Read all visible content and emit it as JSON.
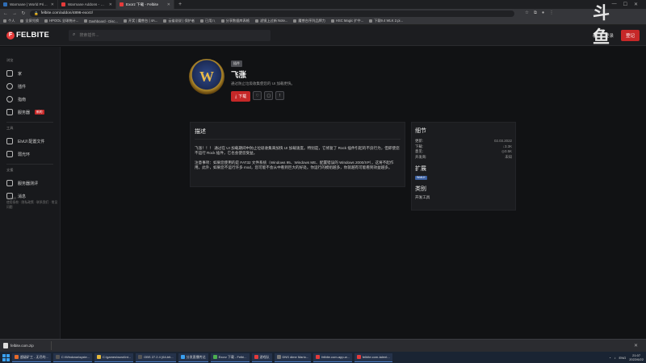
{
  "browser": {
    "tabs": [
      {
        "title": "Warmane | World Private Ser",
        "color": "#2f6db5",
        "active": false
      },
      {
        "title": "Warmane Addons - Felbite",
        "color": "#e53b3b",
        "active": false
      },
      {
        "title": "Exorz 下载 - Felbite",
        "color": "#e53b3b",
        "active": true
      }
    ],
    "new_tab": "+",
    "url": "felbite.com/addon/4896-exorz/",
    "bookmarks": [
      "个人",
      "全屏兑换",
      "HPOOL 全球统计...",
      "Dashboard - Disc...",
      "开奖 | 魔兽台 | 4A...",
      "云雀说说 | 保护者",
      "已用八",
      "分享数据库表格",
      "滤镜上过新 Note...",
      "魔兽台序列品牌力",
      "HSC Magic 扩中...",
      "下载9.4 WLK 2.pi..."
    ]
  },
  "site": {
    "logo_mark": "F",
    "logo_text": "FELBITE",
    "search_placeholder": "搜索插件...",
    "login": "登录",
    "register": "登记"
  },
  "sidebar": {
    "section_1": "浏览",
    "items_1": [
      {
        "label": "家",
        "icon": "home-icon"
      },
      {
        "label": "插件",
        "icon": "plugin-icon"
      },
      {
        "label": "指南",
        "icon": "guide-icon"
      },
      {
        "label": "服务器",
        "icon": "server-icon",
        "badge": "新的"
      }
    ],
    "section_2": "工具",
    "items_2": [
      {
        "label": "ElvUI 配置文件",
        "icon": "elvui-icon"
      },
      {
        "label": "弱光环",
        "icon": "weakaura-icon"
      }
    ],
    "section_3": "支援",
    "items_3": [
      {
        "label": "服务器测评",
        "icon": "review-icon"
      },
      {
        "label": "消息",
        "icon": "news-icon"
      }
    ],
    "footer_line1": "© 2022",
    "footer_line2": "使用条款 · 隐私政策 · 联系我们 · 常见问题"
  },
  "addon": {
    "logo_letter": "W",
    "tag": "插件",
    "name": "飞涨",
    "subtitle": "通过防止垃圾收集使您的 UI 加载更快。",
    "download_label": "下载",
    "action_icons": [
      "heart-icon",
      "bookmark-icon",
      "more-icon"
    ]
  },
  "description": {
    "title": "描述",
    "p1": "飞涨！！！ 通过在 UI 加载期间中防止垃圾收集来加快 UI 加载速度。特别是，它修复了 Rock 插件引起的不良行为，但即使您不运行 Rock 插件，它也会使您受益。",
    "p2": "注意事项：如果您使用的是 FAT32 文件系统（Windows 95、Windows ME、配置错误的 Windows 2000/XP），这将不起作用。此外，如果您不运行许多 mod，您可能不会从中看到巨大的好处。你运行的模组越多，你就越有可能看到效益越多。"
  },
  "details": {
    "title": "细节",
    "rows": [
      {
        "k": "更新:",
        "v": "02.03.2022"
      },
      {
        "k": "下载:",
        "v": "↓3.3K"
      },
      {
        "k": "意见:",
        "v": "◎0.5K"
      },
      {
        "k": "开发商:",
        "v": "未知"
      }
    ],
    "extensions_title": "扩展",
    "extension_badge": "WotLK",
    "category_title": "类别",
    "category_item": "开发工具"
  },
  "download_bar": {
    "file": "felbite.com.zip",
    "close": "✕"
  },
  "taskbar": {
    "items": [
      {
        "label": "超级矿工 - 无尽的...",
        "color": "#e86b2a"
      },
      {
        "label": "C:\\Windows\\syste...",
        "color": "#555"
      },
      {
        "label": "C:\\games\\wow\\Int...",
        "color": "#e5b93a"
      },
      {
        "label": "OBS 27.2.4 (64-bit...",
        "color": "#555"
      },
      {
        "label": "分发直播传达",
        "color": "#3aa0f0"
      },
      {
        "label": "Exorz 下载 - Felbi...",
        "color": "#4caf50"
      },
      {
        "label": "游戏队",
        "color": "#e53b3b"
      },
      {
        "label": "DNS dime Mario...",
        "color": "#777"
      },
      {
        "label": "felbite.com-app-w...",
        "color": "#e53b3b"
      },
      {
        "label": "felbite.com-talent...",
        "color": "#e53b3b"
      }
    ],
    "lang": "ENG",
    "time": "21:07",
    "date": "2022/6/22"
  },
  "watermark": "斗鱼"
}
